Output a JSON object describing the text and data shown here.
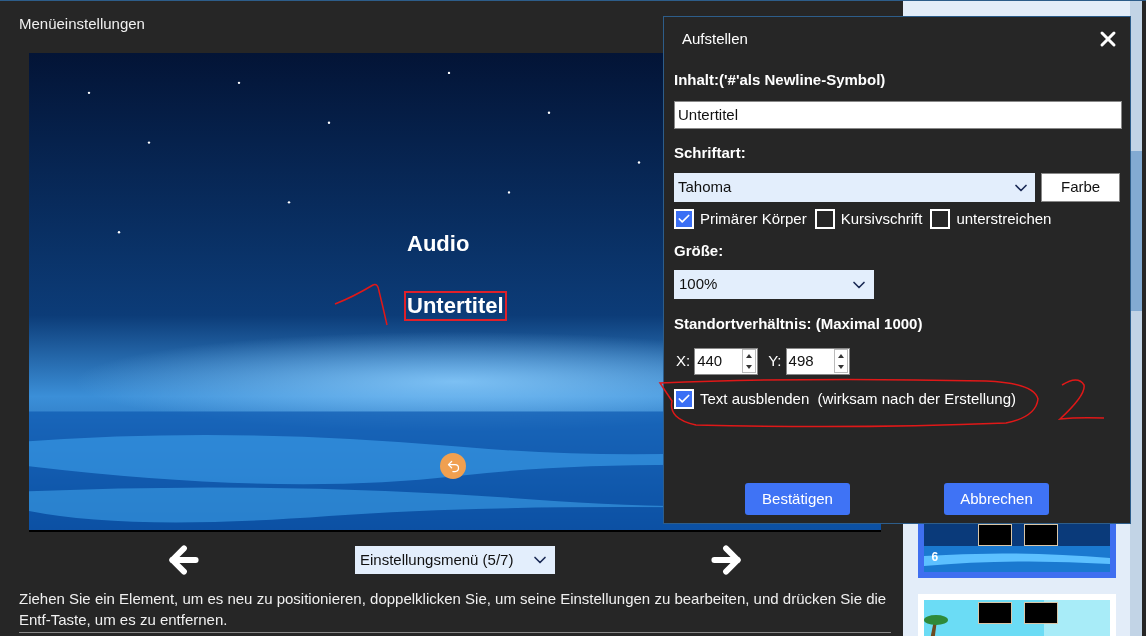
{
  "window": {
    "title": "Menüeinstellungen"
  },
  "preview": {
    "items": [
      {
        "text": "Audio",
        "selected": false
      },
      {
        "text": "Untertitel",
        "selected": true
      }
    ]
  },
  "navigation": {
    "page_select": "Einstellungsmenü (5/7)"
  },
  "hint": "Ziehen Sie ein Element, um es neu zu positionieren, doppelklicken Sie, um seine Einstellungen zu bearbeiten, und drücken Sie die Entf-Taste, um es zu entfernen.",
  "thumbnails": [
    {
      "label": "6",
      "selected": true
    },
    {
      "selected": false
    }
  ],
  "dialog": {
    "title": "Aufstellen",
    "content_label": "Inhalt:('#'als Newline-Symbol)",
    "content_value": "Untertitel",
    "font_label": "Schriftart:",
    "font_value": "Tahoma",
    "color_button": "Farbe",
    "styles": [
      {
        "label": "Primärer Körper",
        "checked": true
      },
      {
        "label": "Kursivschrift",
        "checked": false
      },
      {
        "label": "unterstreichen",
        "checked": false
      }
    ],
    "size_label": "Größe:",
    "size_value": "100%",
    "position_label": "Standortverhältnis: (Maximal 1000)",
    "x_label": "X:",
    "x_value": "440",
    "y_label": "Y:",
    "y_value": "498",
    "hide_text": {
      "label": "Text ausblenden  (wirksam nach der Erstellung)",
      "checked": true
    },
    "buttons": [
      "Bestätigen",
      "Abbrechen"
    ]
  }
}
